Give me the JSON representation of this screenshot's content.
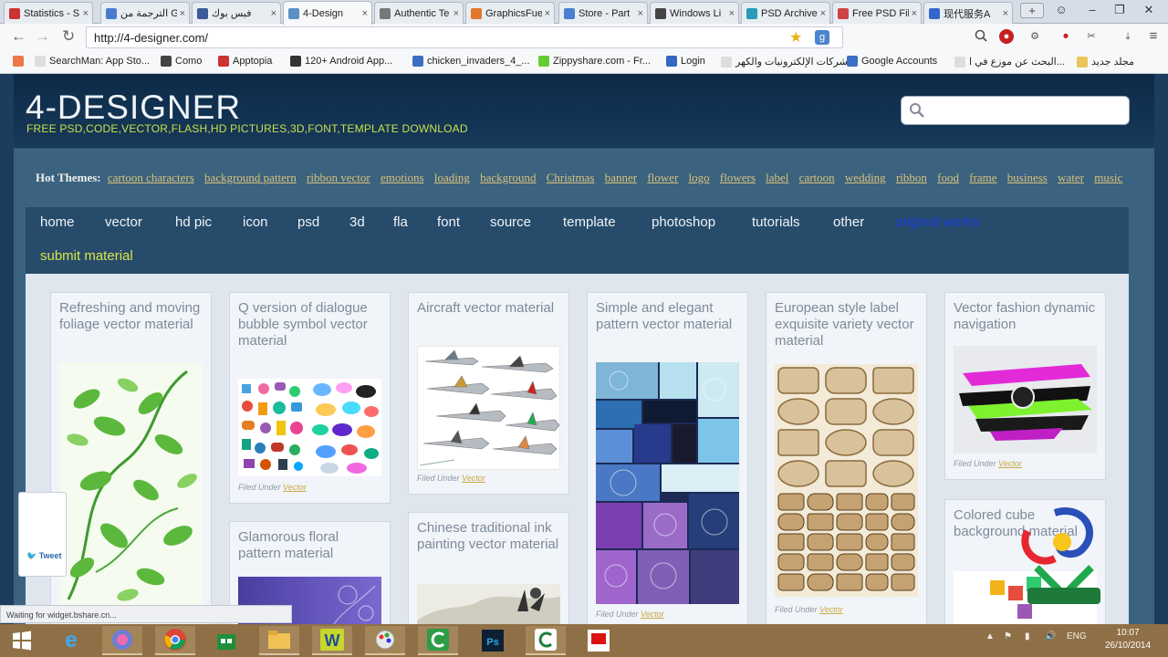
{
  "browser": {
    "tabs": [
      {
        "label": "Statistics - S",
        "color": "#c33"
      },
      {
        "label": "الترجمة من G",
        "color": "#4a7bd0"
      },
      {
        "label": "فيس بوك",
        "color": "#3b5998"
      },
      {
        "label": "4-Design",
        "color": "#5b8fc6",
        "active": true
      },
      {
        "label": "Authentic Te",
        "color": "#777"
      },
      {
        "label": "GraphicsFuel",
        "color": "#e0772b"
      },
      {
        "label": "Store - Part",
        "color": "#4b7fcf"
      },
      {
        "label": "Windows Li",
        "color": "#444"
      },
      {
        "label": "PSD Archive",
        "color": "#2a9ab9"
      },
      {
        "label": "Free PSD Fil",
        "color": "#cc4444"
      },
      {
        "label": "现代服务A",
        "color": "#3366cc"
      }
    ],
    "tab_close": "×",
    "new_tab": "+",
    "url": "http://4-designer.com/",
    "nav": {
      "back": "←",
      "forward": "→",
      "reload": "↻"
    },
    "bookmarks": [
      {
        "label": "",
        "color": "#e74"
      },
      {
        "label": "SearchMan: App Sto...",
        "color": "#ddd"
      },
      {
        "label": "Como",
        "color": "#444"
      },
      {
        "label": "Apptopia",
        "color": "#c33"
      },
      {
        "label": "120+ Android App...",
        "color": "#333"
      },
      {
        "label": "chicken_invaders_4_...",
        "color": "#3a6fc4"
      },
      {
        "label": "Zippyshare.com - Fr...",
        "color": "#6c3"
      },
      {
        "label": "Login",
        "color": "#3466c2"
      },
      {
        "label": "شركات الإلكترونيات والكهر",
        "color": "#ddd"
      },
      {
        "label": "Google Accounts",
        "color": "#3a6fc4"
      },
      {
        "label": "البحث عن موزع في ا...",
        "color": "#ddd"
      },
      {
        "label": "مجلد جديد",
        "color": "#e8c65a"
      }
    ]
  },
  "site": {
    "logo": "4-DESIGNER",
    "tagline": "FREE PSD,CODE,VECTOR,FLASH,HD PICTURES,3D,FONT,TEMPLATE DOWNLOAD",
    "search_placeholder": "",
    "hot_label": "Hot Themes:",
    "hot_themes": [
      "cartoon characters",
      "background pattern",
      "ribbon vector",
      "emotions",
      "loading",
      "background",
      "Christmas",
      "banner",
      "flower",
      "logo",
      "flowers",
      "label",
      "cartoon",
      "wedding",
      "ribbon",
      "food",
      "frame",
      "business",
      "water",
      "music"
    ],
    "nav_items": [
      "home",
      "vector",
      "hd pic",
      "icon",
      "psd",
      "3d",
      "fla",
      "font",
      "source",
      "template",
      "photoshop",
      "tutorials",
      "other",
      "original works"
    ],
    "submit": "submit material",
    "filed_prefix": "Filed Under",
    "cards": [
      {
        "title": "Refreshing and moving foliage vector material",
        "category": ""
      },
      {
        "title": "Q version of dialogue bubble symbol vector material",
        "category": "Vector"
      },
      {
        "title": "Aircraft vector material",
        "category": "Vector"
      },
      {
        "title": "Simple and elegant pattern vector material",
        "category": "Vector"
      },
      {
        "title": "European style label exquisite variety vector material",
        "category": "Vector"
      },
      {
        "title": "Vector fashion dynamic navigation",
        "category": "Vector"
      },
      {
        "title": "Glamorous floral pattern material",
        "category": ""
      },
      {
        "title": "Chinese traditional ink painting vector material",
        "category": ""
      },
      {
        "title": "Colored cube background material",
        "category": ""
      }
    ],
    "tweet": "Tweet",
    "status": "Waiting for widget.bshare.cn..."
  },
  "taskbar": {
    "language": "ENG",
    "time": "10:07",
    "date": "26/10/2014"
  }
}
